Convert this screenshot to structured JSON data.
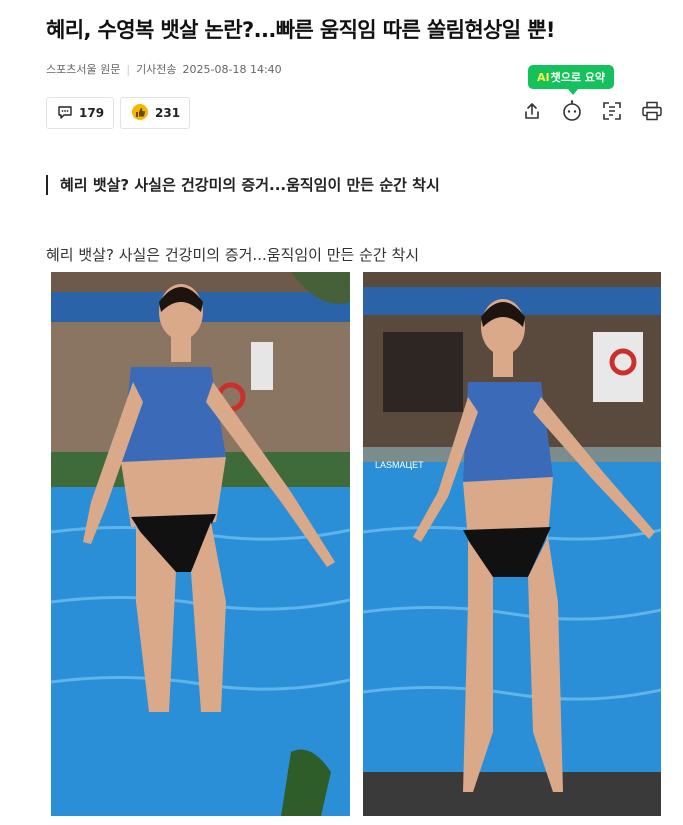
{
  "article": {
    "headline": "혜리, 수영복 뱃살 논란?...빠른 움직임 따른 쏠림현상일 뿐!",
    "source": "스포츠서울 원문",
    "published_label": "기사전송",
    "published_at": "2025-08-18 14:40",
    "subheading": "혜리 뱃살? 사실은 건강미의 증거...움직임이 만든 순간 착시",
    "image_caption": "혜리 뱃살? 사실은 건강미의 증거...움직임이 만든 순간 착시"
  },
  "reactions": {
    "comments": "179",
    "likes": "231"
  },
  "tools": {
    "ai_summary_ai": "AI",
    "ai_summary_rest": "챗으로 요약",
    "icons": [
      "share-icon",
      "ai-chatbot-icon",
      "scan-icon",
      "print-icon"
    ]
  },
  "photos": {
    "left_overlay": "",
    "right_overlay": "LASMAЦЕТ"
  },
  "colors": {
    "accent_green": "#13c25a",
    "pool_blue": "#2a8fd6",
    "like_yellow": "#f5b800"
  }
}
